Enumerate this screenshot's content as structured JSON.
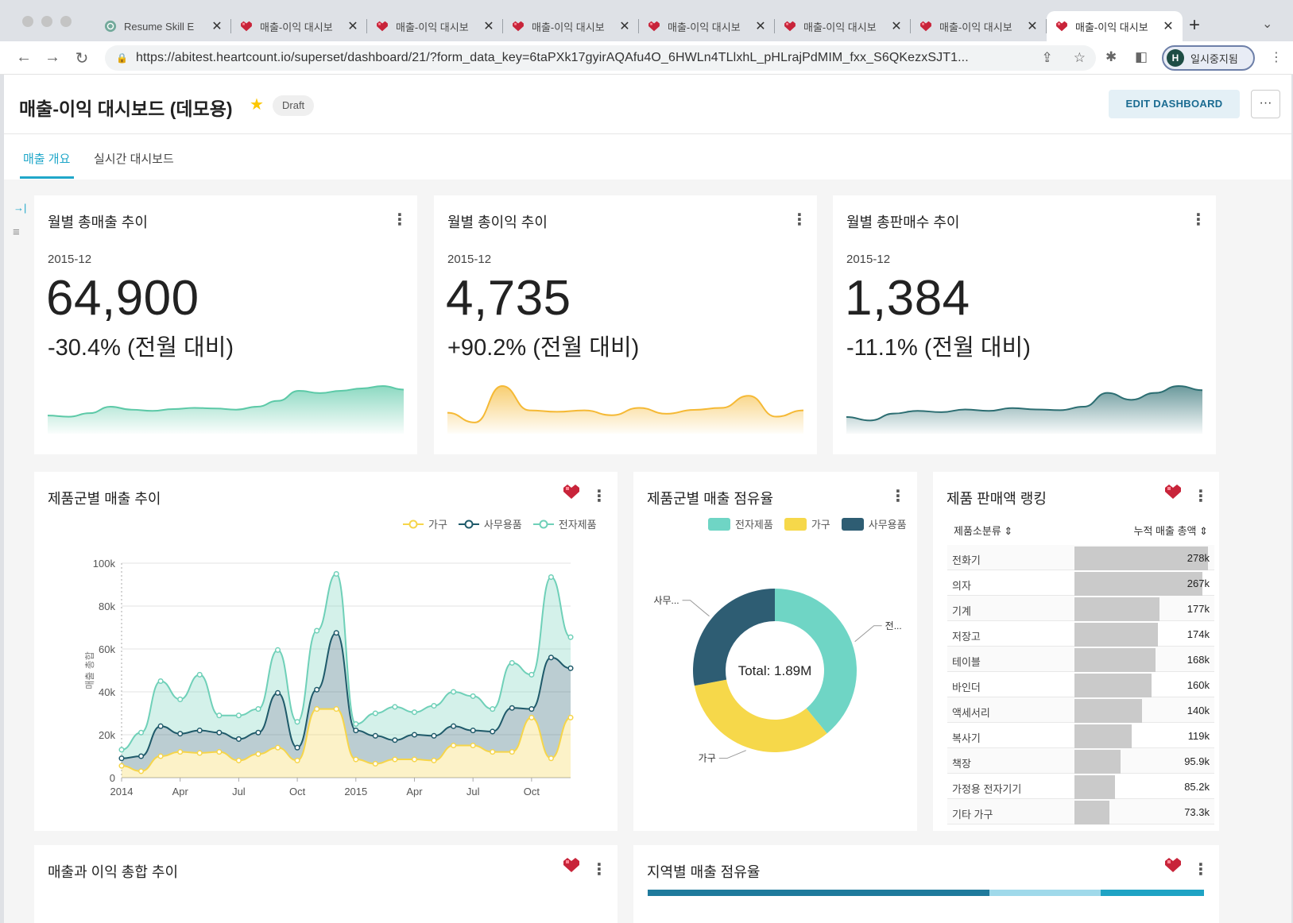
{
  "browser": {
    "tabs": [
      {
        "title": "Resume Skill E",
        "icon": "chatgpt-icon"
      },
      {
        "title": "매출-이익 대시보",
        "icon": "heart-pixel-icon"
      },
      {
        "title": "매출-이익 대시보",
        "icon": "heart-pixel-icon"
      },
      {
        "title": "매출-이익 대시보",
        "icon": "heart-pixel-icon"
      },
      {
        "title": "매출-이익 대시보",
        "icon": "heart-pixel-icon"
      },
      {
        "title": "매출-이익 대시보",
        "icon": "heart-pixel-icon"
      },
      {
        "title": "매출-이익 대시보",
        "icon": "heart-pixel-icon"
      },
      {
        "title": "매출-이익 대시보",
        "icon": "heart-pixel-icon"
      }
    ],
    "url": "https://abitest.heartcount.io/superset/dashboard/21/?form_data_key=6taPXk17gyirAQAfu4O_6HWLn4TLlxhL_pHLrajPdMIM_fxx_S6QKezxSJT1...",
    "profile_initial": "H",
    "profile_label": "일시중지됨"
  },
  "dashboard": {
    "title": "매출-이익 대시보드 (데모용)",
    "status": "Draft",
    "edit_label": "EDIT DASHBOARD",
    "more_label": "···",
    "tabs": [
      "매출 개요",
      "실시간 대시보드"
    ]
  },
  "big_numbers": [
    {
      "title": "월별 총매출 추이",
      "date": "2015-12",
      "value": "64,900",
      "change": "-30.4% (전월 대비)",
      "color": "#5cc9a7",
      "trend": [
        20,
        18,
        24,
        35,
        30,
        28,
        31,
        33,
        32,
        30,
        35,
        45,
        62,
        58,
        62,
        66,
        70,
        64
      ]
    },
    {
      "title": "월별 총이익 추이",
      "date": "2015-12",
      "value": "4,735",
      "change": "+90.2% (전월 대비)",
      "color": "#f5b935",
      "trend": [
        30,
        10,
        85,
        35,
        32,
        35,
        25,
        40,
        28,
        36,
        40,
        65,
        22,
        35
      ]
    },
    {
      "title": "월별 총판매수 추이",
      "date": "2015-12",
      "value": "1,384",
      "change": "-11.1% (전월 대비)",
      "color": "#2c6e72",
      "trend": [
        15,
        10,
        20,
        24,
        22,
        26,
        24,
        28,
        26,
        25,
        30,
        50,
        40,
        50,
        60,
        54
      ]
    }
  ],
  "line_chart": {
    "title": "제품군별 매출 추이",
    "legend": [
      "가구",
      "사무용품",
      "전자제품"
    ]
  },
  "chart_data": [
    {
      "type": "area",
      "title": "제품군별 매출 추이",
      "ylabel": "매출 총합",
      "x": [
        "2014-01",
        "2014-02",
        "2014-03",
        "2014-04",
        "2014-05",
        "2014-06",
        "2014-07",
        "2014-08",
        "2014-09",
        "2014-10",
        "2014-11",
        "2014-12",
        "2015-01",
        "2015-02",
        "2015-03",
        "2015-04",
        "2015-05",
        "2015-06",
        "2015-07",
        "2015-08",
        "2015-09",
        "2015-10",
        "2015-11",
        "2015-12"
      ],
      "x_ticks": [
        "2014",
        "Apr",
        "Jul",
        "Oct",
        "2015",
        "Apr",
        "Jul",
        "Oct"
      ],
      "y_ticks": [
        "0",
        "20k",
        "40k",
        "60k",
        "80k",
        "100k"
      ],
      "ylim": [
        0,
        100000
      ],
      "stacked": true,
      "series": [
        {
          "name": "가구",
          "color": "#f6d54a",
          "values": [
            5500,
            3000,
            10000,
            12000,
            11500,
            12000,
            8000,
            11000,
            14000,
            8000,
            32000,
            32000,
            8500,
            6500,
            8500,
            8500,
            8000,
            15000,
            15000,
            12000,
            12000,
            28000,
            9000,
            28000
          ]
        },
        {
          "name": "사무용품",
          "color": "#1f5a6a",
          "values": [
            3500,
            7000,
            14000,
            8500,
            10500,
            9000,
            10000,
            10000,
            25500,
            6000,
            9000,
            35500,
            13500,
            13000,
            9000,
            11500,
            11500,
            9000,
            7000,
            9500,
            20500,
            4000,
            47000,
            23000
          ]
        },
        {
          "name": "전자제품",
          "color": "#6fd0b8",
          "values": [
            4000,
            11000,
            21000,
            16000,
            26000,
            8000,
            11000,
            11000,
            20000,
            12000,
            27500,
            27500,
            3000,
            10500,
            15500,
            10500,
            14000,
            16000,
            16000,
            10500,
            21000,
            16000,
            37500,
            14500
          ]
        }
      ]
    },
    {
      "type": "pie",
      "title": "제품군별 매출 점유율",
      "total_label": "Total: 1.89M",
      "series": [
        {
          "name": "전자제품",
          "color": "#6fd5c5",
          "value": 0.39,
          "label": "전..."
        },
        {
          "name": "가구",
          "color": "#f6d84a",
          "value": 0.33,
          "label": "가구"
        },
        {
          "name": "사무용품",
          "color": "#2e5d73",
          "value": 0.28,
          "label": "사무..."
        }
      ]
    },
    {
      "type": "table",
      "title": "제품 판매액 랭킹",
      "columns": [
        "제품소분류",
        "누적 매출 총액"
      ],
      "rows": [
        {
          "name": "전화기",
          "label": "278k",
          "value": 278
        },
        {
          "name": "의자",
          "label": "267k",
          "value": 267
        },
        {
          "name": "기계",
          "label": "177k",
          "value": 177
        },
        {
          "name": "저장고",
          "label": "174k",
          "value": 174
        },
        {
          "name": "테이블",
          "label": "168k",
          "value": 168
        },
        {
          "name": "바인더",
          "label": "160k",
          "value": 160
        },
        {
          "name": "액세서리",
          "label": "140k",
          "value": 140
        },
        {
          "name": "복사기",
          "label": "119k",
          "value": 119
        },
        {
          "name": "책장",
          "label": "95.9k",
          "value": 95.9
        },
        {
          "name": "가정용 전자기기",
          "label": "85.2k",
          "value": 85.2
        },
        {
          "name": "기타 가구",
          "label": "73.3k",
          "value": 73.3
        }
      ]
    }
  ],
  "bottom_cards": [
    "매출과 이익 총합 추이",
    "지역별 매출 점유율"
  ]
}
